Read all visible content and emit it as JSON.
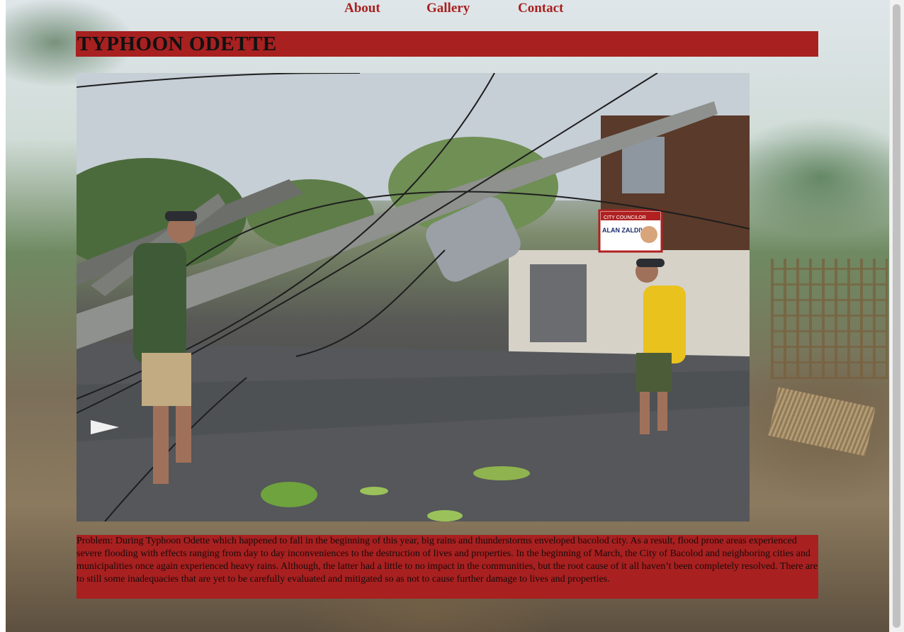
{
  "nav": {
    "about": "About",
    "gallery": "Gallery",
    "contact": "Contact"
  },
  "header": {
    "title": "TYPHOON ODETTE"
  },
  "photo": {
    "sign_text": "ALAN ZALDIVAR",
    "sign_subtitle": "CITY COUNCILOR"
  },
  "article": {
    "problem_text": "Problem: During Typhoon Odette which happened to fall in the beginning of this year, big rains and thunderstorms enveloped bacolod city. As a result, flood prone areas experienced severe flooding with effects ranging from day to day inconveniences to the destruction of lives and properties. In the beginning of March, the City of Bacolod and neighboring cities and municipalities once again experienced heavy rains. Although, the latter had a little to no impact in the communities, but the root cause of it all haven’t been completely resolved. There are to still some inadequacies that are yet to be carefully evaluated and mitigated so as not to cause further damage to lives and properties."
  },
  "colors": {
    "accent": "#a82020",
    "title_text": "#111111"
  }
}
